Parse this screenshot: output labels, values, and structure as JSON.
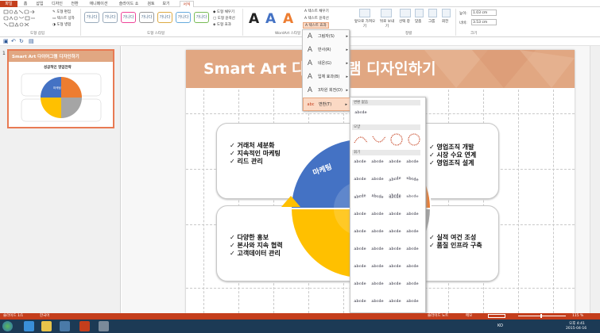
{
  "tabs": [
    "파일",
    "홈",
    "삽입",
    "디자인",
    "전환",
    "애니메이션",
    "슬라이드 쇼",
    "검토",
    "보기",
    "서식"
  ],
  "ribbon": {
    "shape_insert_label": "도형 삽입",
    "shape_styles_label": "도형 스타일",
    "wordart_styles_label": "WordArt 스타일",
    "arrange_label": "정렬",
    "size_label": "크기",
    "edit_shape": "도형 편집",
    "textbox": "텍스트 상자",
    "merge_shapes": "도형 병합",
    "shape_fill": "도형 채우기",
    "shape_outline": "도형 윤곽선",
    "shape_effects": "도형 효과",
    "style_sample": "가나다",
    "text_fill": "텍스트 채우기",
    "text_outline": "텍스트 윤곽선",
    "text_effects": "텍스트 효과",
    "bring_forward": "앞으로 가져오기",
    "send_backward": "뒤로 보내기",
    "selection_pane": "선택 창",
    "align": "맞춤",
    "group": "그룹",
    "rotate": "회전",
    "height_label": "높이:",
    "height_value": "1.03 cm",
    "width_label": "너비:",
    "width_value": "3.53 cm",
    "wordart_letter": "A"
  },
  "thumbnail": {
    "number": "1",
    "title": "Smart Art 다이어그램 디자인하기",
    "subtitle": "성공적인 영업전략",
    "center": "마케팅"
  },
  "slide": {
    "title": "Smart Art 다이어그램 디자인하기",
    "center_label": "마케팅",
    "quad_tl": [
      "거래처 세분화",
      "지속적인 마케팅",
      "리드 관리"
    ],
    "quad_tr": [
      "영업조직 개발",
      "시장 수요 연계",
      "영업조직 설계"
    ],
    "quad_bl": [
      "다양한 홍보",
      "본사와 지속 협력",
      "고객데이터 관리"
    ],
    "quad_br": [
      "실적 여건 조성",
      "품질 인프라 구축"
    ]
  },
  "menu": {
    "items": [
      "그림자(S)",
      "반사(R)",
      "네온(G)",
      "입체 효과(B)",
      "3차원 회전(D)",
      "변환(T)"
    ],
    "icons": [
      "A",
      "A",
      "A",
      "A",
      "A",
      "abc"
    ]
  },
  "submenu": {
    "section_none": "변환 없음",
    "none_sample": "abcde",
    "section_follow": "모양",
    "section_warp": "휘기",
    "sample": "abcde"
  },
  "status": {
    "slide_counter": "슬라이드 1/1",
    "language": "한국어",
    "notes": "슬라이드 노트",
    "comments": "메모",
    "zoom": "115 %"
  },
  "taskbar": {
    "time": "오후 4:41",
    "date": "2015-04-16",
    "lang": "KO"
  },
  "colors": {
    "accent": "#c43e1c",
    "banner": "#e1a782",
    "blue": "#4472c4",
    "orange": "#ed7d31",
    "yellow": "#ffc000",
    "gray": "#a5a5a5"
  }
}
